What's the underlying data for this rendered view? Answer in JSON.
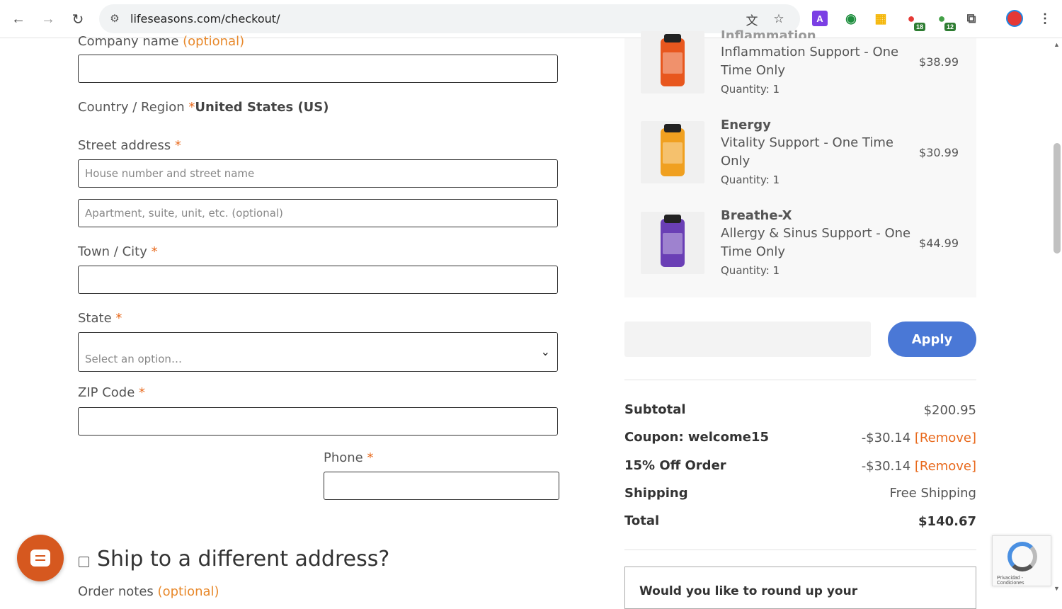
{
  "browser": {
    "url": "lifeseasons.com/checkout/",
    "ext_badge_1": "18",
    "ext_badge_2": "12"
  },
  "form": {
    "company": {
      "label": "Company name",
      "optional": "(optional)"
    },
    "country": {
      "label": "Country / Region",
      "req": "*",
      "value": "United States (US)"
    },
    "street": {
      "label": "Street address",
      "req": "*",
      "placeholder1": "House number and street name",
      "placeholder2": "Apartment, suite, unit, etc. (optional)"
    },
    "city": {
      "label": "Town / City",
      "req": "*"
    },
    "state": {
      "label": "State",
      "req": "*",
      "value": "Select an option…"
    },
    "zip": {
      "label": "ZIP Code",
      "req": "*"
    },
    "phone": {
      "label": "Phone",
      "req": "*"
    },
    "ship_different": "Ship to a different address?",
    "order_notes": {
      "label": "Order notes",
      "optional": "(optional)"
    }
  },
  "items": [
    {
      "name": "Inflammation",
      "desc": "Inflammation Support - One Time Only",
      "qty": "Quantity: 1",
      "price": "$38.99",
      "color": "#e8571e"
    },
    {
      "name": "Energy",
      "desc": "Vitality Support - One Time Only",
      "qty": "Quantity: 1",
      "price": "$30.99",
      "color": "#f0a020"
    },
    {
      "name": "Breathe-X",
      "desc": "Allergy & Sinus Support - One Time Only",
      "qty": "Quantity: 1",
      "price": "$44.99",
      "color": "#6a3fb5"
    }
  ],
  "coupon": {
    "apply_label": "Apply"
  },
  "totals": {
    "subtotal_label": "Subtotal",
    "subtotal": "$200.95",
    "coupon_label": "Coupon: welcome15",
    "coupon_val": "-$30.14",
    "coupon_remove": "[Remove]",
    "off_label": "15% Off Order",
    "off_val": "-$30.14",
    "off_remove": "[Remove]",
    "shipping_label": "Shipping",
    "shipping": "Free Shipping",
    "total_label": "Total",
    "total": "$140.67"
  },
  "roundup": "Would you like to round up your",
  "recaptcha": "Privacidad - Condiciones"
}
